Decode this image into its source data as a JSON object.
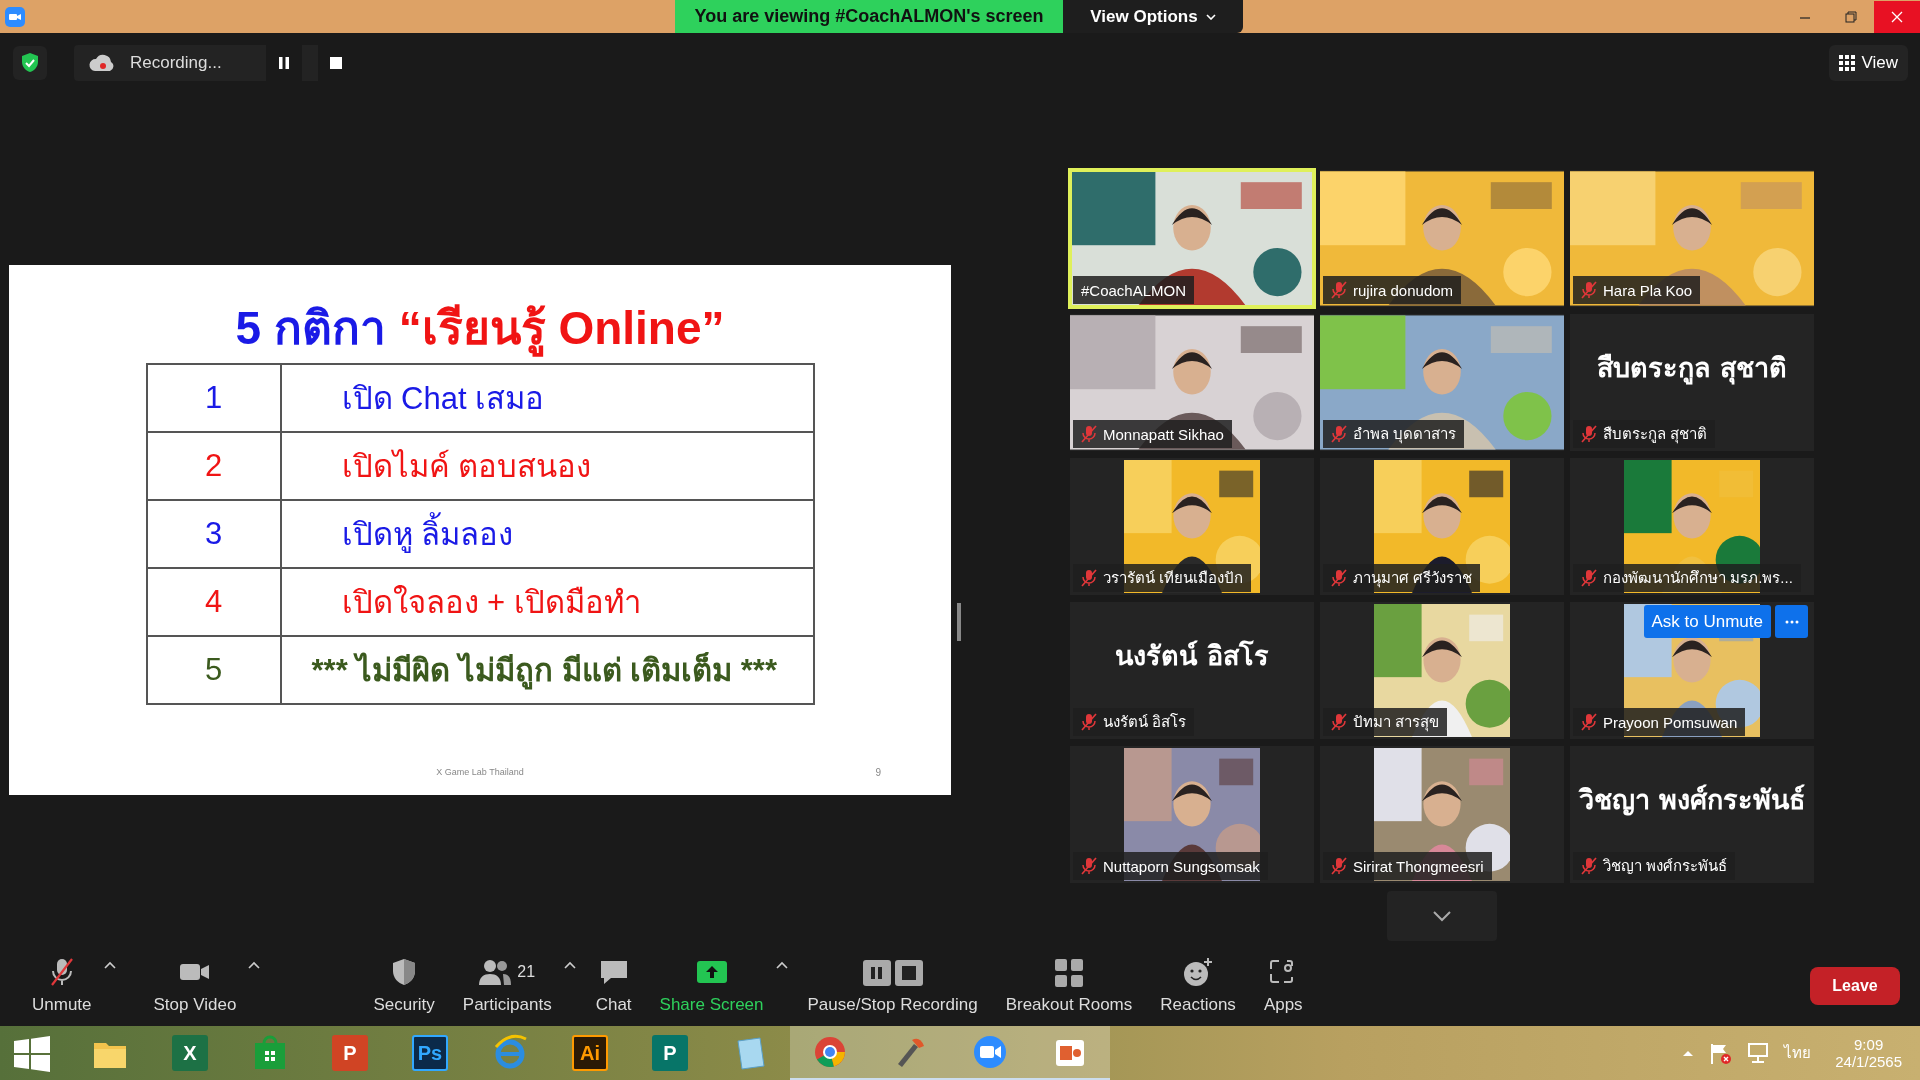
{
  "title_bar": {
    "banner": "You are viewing #CoachALMON's screen",
    "view_options": "View Options"
  },
  "meeting_bar": {
    "recording": "Recording...",
    "view": "View"
  },
  "slide": {
    "title": [
      {
        "text": "5 กติกา ",
        "color": "#1a1ae6"
      },
      {
        "text": "“เรียนรู้ Online”",
        "color": "#f01414"
      }
    ],
    "rows": [
      {
        "number": "1",
        "text": "เปิด Chat เสมอ",
        "color": "#1a1ae6"
      },
      {
        "number": "2",
        "text": "เปิดไมค์ ตอบสนอง",
        "color": "#f01414"
      },
      {
        "number": "3",
        "text": "เปิดหู ลิ้มลอง",
        "color": "#1a1ae6"
      },
      {
        "number": "4",
        "text": "เปิดใจลอง + เปิดมือทำ",
        "color": "#f01414"
      },
      {
        "number": "5",
        "text": "*** ไม่มีผิด ไม่มีถูก มีแต่ เติมเต็ม ***",
        "color": "#3b5a1e"
      }
    ],
    "footer": "X Game Lab Thailand",
    "page": "9"
  },
  "participants": [
    {
      "name": "#CoachALMON",
      "kind": "video",
      "muted": false,
      "selected": true
    },
    {
      "name": "rujira donudom",
      "kind": "video",
      "muted": true,
      "selected": false
    },
    {
      "name": "Hara Pla Koo",
      "kind": "video",
      "muted": true,
      "selected": false
    },
    {
      "name": "Monnapatt Sikhao",
      "kind": "video",
      "muted": true,
      "selected": false
    },
    {
      "name": "อำพล บุดดาสาร",
      "kind": "video",
      "muted": true,
      "selected": false
    },
    {
      "name": "สืบตระกูล สุชาติ",
      "kind": "name",
      "big_name": "สืบตระกูล สุชาติ",
      "muted": true,
      "selected": false
    },
    {
      "name": "วรารัตน์ เทียนเมืองปัก",
      "muted": true,
      "selected": false
    },
    {
      "name": "ภานุมาศ ศรีวังราช",
      "muted": true,
      "selected": false
    },
    {
      "name": "กองพัฒนานักศึกษา มรภ.พร...",
      "muted": true,
      "selected": false
    },
    {
      "name": "นงรัตน์ อิสโร",
      "kind": "name",
      "big_name": "นงรัตน์ อิสโร",
      "muted": true,
      "selected": false
    },
    {
      "name": "ปัทมา สารสุข",
      "muted": true,
      "selected": false
    },
    {
      "name": "Prayoon Pomsuwan",
      "muted": true,
      "selected": false,
      "ask_button": "Ask to Unmute"
    },
    {
      "name": "Nuttaporn Sungsomsak",
      "muted": true,
      "selected": false
    },
    {
      "name": "Sirirat Thongmeesri",
      "muted": true,
      "selected": false
    },
    {
      "name": "วิชญา พงศ์กระพันธ์",
      "kind": "name",
      "big_name": "วิชญา พงศ์กระพันธ์",
      "muted": true,
      "selected": false
    }
  ],
  "toolbar": [
    {
      "kind": "mic",
      "label": "Unmute",
      "muted": true,
      "caret": true
    },
    {
      "kind": "video",
      "label": "Stop Video",
      "caret": true
    },
    {
      "kind": "security",
      "label": "Security"
    },
    {
      "kind": "participants",
      "label": "Participants",
      "count": "21",
      "caret": true
    },
    {
      "kind": "chat",
      "label": "Chat"
    },
    {
      "kind": "share",
      "label": "Share Screen",
      "caret": true
    },
    {
      "kind": "recording",
      "label": "Pause/Stop Recording"
    },
    {
      "kind": "breakout",
      "label": "Breakout Rooms"
    },
    {
      "kind": "reactions",
      "label": "Reactions"
    },
    {
      "kind": "apps",
      "label": "Apps"
    }
  ],
  "leave": "Leave",
  "taskbar": {
    "apps": [
      {
        "kind": "folder",
        "open": false
      },
      {
        "kind": "excel",
        "glyph": "X",
        "open": false
      },
      {
        "kind": "store",
        "open": false
      },
      {
        "kind": "powerpoint",
        "glyph": "P",
        "open": false
      },
      {
        "kind": "photoshop",
        "glyph": "Ps",
        "open": false
      },
      {
        "kind": "browser-e",
        "open": false
      },
      {
        "kind": "illustrator",
        "glyph": "Ai",
        "open": false
      },
      {
        "kind": "publisher",
        "glyph": "P",
        "open": false
      },
      {
        "kind": "notepad",
        "open": false
      },
      {
        "kind": "chrome",
        "open": true
      },
      {
        "kind": "paint",
        "open": true
      },
      {
        "kind": "zoom",
        "open": true
      },
      {
        "kind": "slides",
        "open": true
      }
    ],
    "language": "ไทย",
    "time": "9:09",
    "date": "24/1/2565"
  }
}
